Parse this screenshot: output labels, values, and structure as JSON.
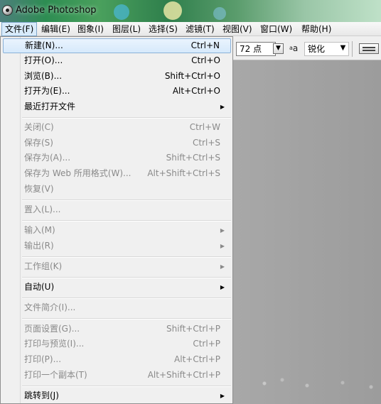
{
  "window": {
    "title": "Adobe Photoshop"
  },
  "menubar": {
    "items": [
      "文件(F)",
      "编辑(E)",
      "图象(I)",
      "图层(L)",
      "选择(S)",
      "滤镜(T)",
      "视图(V)",
      "窗口(W)",
      "帮助(H)"
    ]
  },
  "toolbar": {
    "font_size": "72 点",
    "antialias_prefix": "a",
    "antialias_label": "a",
    "antialias_value": "锐化"
  },
  "file_menu": {
    "items": [
      {
        "label": "新建(N)...",
        "shortcut": "Ctrl+N",
        "enabled": true
      },
      {
        "label": "打开(O)...",
        "shortcut": "Ctrl+O",
        "enabled": true
      },
      {
        "label": "浏览(B)...",
        "shortcut": "Shift+Ctrl+O",
        "enabled": true
      },
      {
        "label": "打开为(E)...",
        "shortcut": "Alt+Ctrl+O",
        "enabled": true
      },
      {
        "label": "最近打开文件",
        "shortcut": "",
        "enabled": true,
        "submenu": true
      },
      {
        "label": "关闭(C)",
        "shortcut": "Ctrl+W",
        "enabled": false
      },
      {
        "label": "保存(S)",
        "shortcut": "Ctrl+S",
        "enabled": false
      },
      {
        "label": "保存为(A)...",
        "shortcut": "Shift+Ctrl+S",
        "enabled": false
      },
      {
        "label": "保存为 Web 所用格式(W)...",
        "shortcut": "Alt+Shift+Ctrl+S",
        "enabled": false
      },
      {
        "label": "恢复(V)",
        "shortcut": "",
        "enabled": false
      },
      {
        "label": "置入(L)...",
        "shortcut": "",
        "enabled": false
      },
      {
        "label": "输入(M)",
        "shortcut": "",
        "enabled": false,
        "submenu": true
      },
      {
        "label": "输出(R)",
        "shortcut": "",
        "enabled": false,
        "submenu": true
      },
      {
        "label": "工作组(K)",
        "shortcut": "",
        "enabled": false,
        "submenu": true
      },
      {
        "label": "自动(U)",
        "shortcut": "",
        "enabled": true,
        "submenu": true
      },
      {
        "label": "文件简介(I)...",
        "shortcut": "",
        "enabled": false
      },
      {
        "label": "页面设置(G)...",
        "shortcut": "Shift+Ctrl+P",
        "enabled": false
      },
      {
        "label": "打印与预览(I)...",
        "shortcut": "Ctrl+P",
        "enabled": false
      },
      {
        "label": "打印(P)...",
        "shortcut": "Alt+Ctrl+P",
        "enabled": false
      },
      {
        "label": "打印一个副本(T)",
        "shortcut": "Alt+Shift+Ctrl+P",
        "enabled": false
      },
      {
        "label": "跳转到(J)",
        "shortcut": "",
        "enabled": true,
        "submenu": true
      }
    ]
  }
}
